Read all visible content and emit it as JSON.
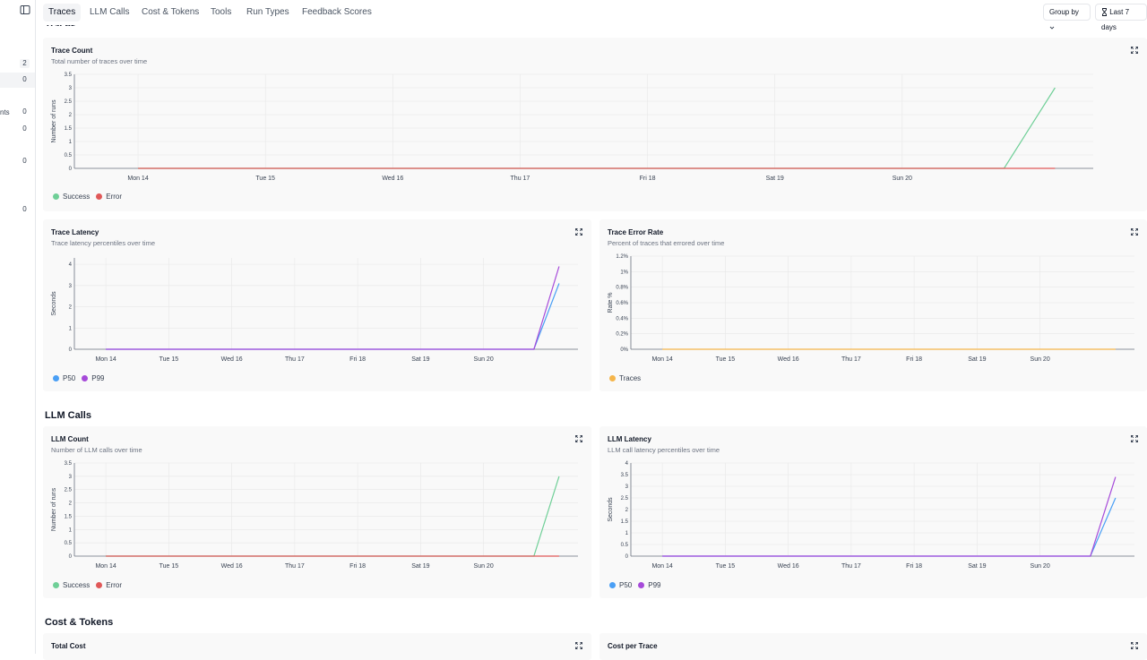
{
  "sidebar": {
    "counts": [
      "2",
      "0",
      "0",
      "0",
      "0",
      "0"
    ],
    "fragment": "nts"
  },
  "topbar": {
    "tabs": [
      "Traces",
      "LLM Calls",
      "Cost & Tokens",
      "Tools",
      "Run Types",
      "Feedback Scores"
    ],
    "group_by": "Group by",
    "date_range": "Last 7 days"
  },
  "colors": {
    "success": "#6fcf97",
    "error": "#e05858",
    "p50": "#4a9ff5",
    "p99": "#a64ad9",
    "traces": "#f5b54a"
  },
  "sections": {
    "traces_partial": "Traces",
    "llm_calls": "LLM Calls",
    "cost_tokens": "Cost & Tokens"
  },
  "charts": {
    "trace_count": {
      "title": "Trace Count",
      "subtitle": "Total number of traces over time",
      "chart_data": {
        "type": "line",
        "ylabel": "Number of runs",
        "x_ticks": [
          "Mon 14",
          "Tue 15",
          "Wed 16",
          "Thu 17",
          "Fri 18",
          "Sat 19",
          "Sun 20"
        ],
        "y_ticks": [
          "0",
          "0.5",
          "1",
          "1.5",
          "2",
          "2.5",
          "3",
          "3.5"
        ],
        "ylim": [
          0,
          3.5
        ],
        "series": [
          {
            "name": "Success",
            "color": "#6fcf97",
            "points": [
              [
                0,
                0
              ],
              [
                6.8,
                0
              ],
              [
                7.2,
                3
              ]
            ]
          },
          {
            "name": "Error",
            "color": "#e05858",
            "points": [
              [
                0,
                0
              ],
              [
                7.2,
                0
              ]
            ]
          }
        ]
      }
    },
    "trace_latency": {
      "title": "Trace Latency",
      "subtitle": "Trace latency percentiles over time",
      "chart_data": {
        "type": "line",
        "ylabel": "Seconds",
        "x_ticks": [
          "Mon 14",
          "Tue 15",
          "Wed 16",
          "Thu 17",
          "Fri 18",
          "Sat 19",
          "Sun 20"
        ],
        "y_ticks": [
          "0",
          "1",
          "2",
          "3",
          "4"
        ],
        "ylim": [
          0,
          4.3
        ],
        "series": [
          {
            "name": "P50",
            "color": "#4a9ff5",
            "points": [
              [
                0,
                0
              ],
              [
                6.8,
                0
              ],
              [
                7.2,
                3.1
              ]
            ]
          },
          {
            "name": "P99",
            "color": "#a64ad9",
            "points": [
              [
                0,
                0
              ],
              [
                6.8,
                0
              ],
              [
                7.2,
                3.9
              ]
            ]
          }
        ]
      }
    },
    "trace_error_rate": {
      "title": "Trace Error Rate",
      "subtitle": "Percent of traces that errored over time",
      "chart_data": {
        "type": "line",
        "ylabel": "Rate %",
        "x_ticks": [
          "Mon 14",
          "Tue 15",
          "Wed 16",
          "Thu 17",
          "Fri 18",
          "Sat 19",
          "Sun 20"
        ],
        "y_ticks": [
          "0%",
          "0.2%",
          "0.4%",
          "0.6%",
          "0.8%",
          "1%",
          "1.2%"
        ],
        "ylim": [
          0,
          1.2
        ],
        "series": [
          {
            "name": "Traces",
            "color": "#f5b54a",
            "points": [
              [
                0,
                0
              ],
              [
                7.2,
                0
              ]
            ]
          }
        ]
      }
    },
    "llm_count": {
      "title": "LLM Count",
      "subtitle": "Number of LLM calls over time",
      "chart_data": {
        "type": "line",
        "ylabel": "Number of runs",
        "x_ticks": [
          "Mon 14",
          "Tue 15",
          "Wed 16",
          "Thu 17",
          "Fri 18",
          "Sat 19",
          "Sun 20"
        ],
        "y_ticks": [
          "0",
          "0.5",
          "1",
          "1.5",
          "2",
          "2.5",
          "3",
          "3.5"
        ],
        "ylim": [
          0,
          3.5
        ],
        "series": [
          {
            "name": "Success",
            "color": "#6fcf97",
            "points": [
              [
                0,
                0
              ],
              [
                6.8,
                0
              ],
              [
                7.2,
                3
              ]
            ]
          },
          {
            "name": "Error",
            "color": "#e05858",
            "points": [
              [
                0,
                0
              ],
              [
                7.2,
                0
              ]
            ]
          }
        ]
      }
    },
    "llm_latency": {
      "title": "LLM Latency",
      "subtitle": "LLM call latency percentiles over time",
      "chart_data": {
        "type": "line",
        "ylabel": "Seconds",
        "x_ticks": [
          "Mon 14",
          "Tue 15",
          "Wed 16",
          "Thu 17",
          "Fri 18",
          "Sat 19",
          "Sun 20"
        ],
        "y_ticks": [
          "0",
          "0.5",
          "1",
          "1.5",
          "2",
          "2.5",
          "3",
          "3.5",
          "4"
        ],
        "ylim": [
          0,
          4
        ],
        "series": [
          {
            "name": "P50",
            "color": "#4a9ff5",
            "points": [
              [
                0,
                0
              ],
              [
                6.8,
                0
              ],
              [
                7.2,
                2.5
              ]
            ]
          },
          {
            "name": "P99",
            "color": "#a64ad9",
            "points": [
              [
                0,
                0
              ],
              [
                6.8,
                0
              ],
              [
                7.2,
                3.4
              ]
            ]
          }
        ]
      }
    },
    "total_cost": {
      "title": "Total Cost"
    },
    "cost_per_trace": {
      "title": "Cost per Trace"
    }
  }
}
